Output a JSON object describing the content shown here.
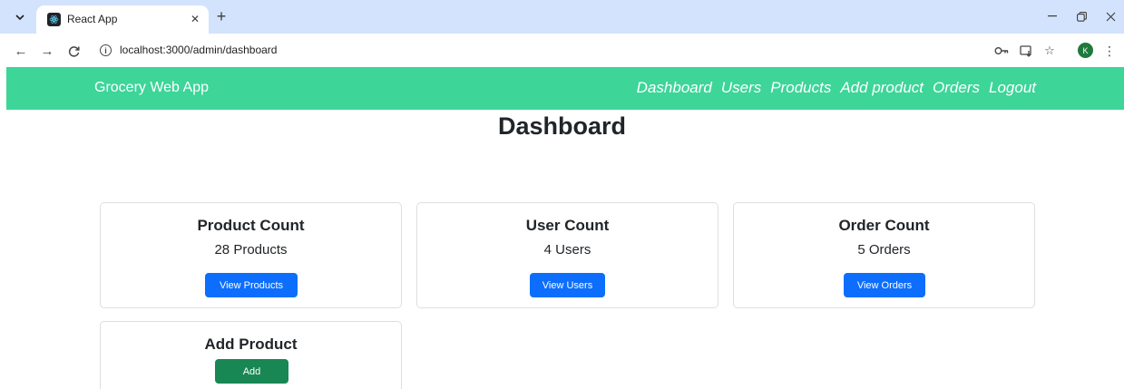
{
  "browser": {
    "tab": {
      "title": "React App"
    },
    "url": "localhost:3000/admin/dashboard",
    "profile_initial": "K"
  },
  "navbar": {
    "brand": "Grocery Web App",
    "links": [
      "Dashboard",
      "Users",
      "Products",
      "Add product",
      "Orders",
      "Logout"
    ]
  },
  "page": {
    "title": "Dashboard"
  },
  "cards": [
    {
      "title": "Product Count",
      "count": "28 Products",
      "button": "View Products"
    },
    {
      "title": "User Count",
      "count": "4 Users",
      "button": "View Users"
    },
    {
      "title": "Order Count",
      "count": "5 Orders",
      "button": "View Orders"
    },
    {
      "title": "Add Product",
      "button": "Add"
    }
  ],
  "colors": {
    "navbar_bg": "#3dd598",
    "primary_button": "#0d6efd",
    "success_button": "#198754",
    "tabstrip_bg": "#d3e3fd"
  },
  "icons": {
    "tab_menu": "chevron-down-icon",
    "tab_favicon": "react-icon",
    "tab_close": "close-icon",
    "new_tab": "plus-icon",
    "back": "arrow-left-icon",
    "forward": "arrow-right-icon",
    "reload": "reload-icon",
    "site_info": "info-icon",
    "password": "key-icon",
    "install": "install-app-icon",
    "bookmark": "star-icon",
    "menu": "more-vert-icon"
  }
}
